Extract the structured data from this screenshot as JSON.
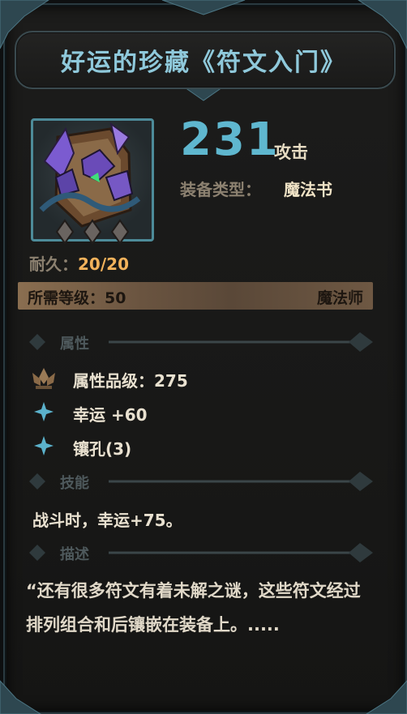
{
  "title": "好运的珍藏《符文入门》",
  "attack": {
    "value": "231",
    "label": "攻击"
  },
  "equip_type": {
    "label": "装备类型：",
    "value": "魔法书"
  },
  "durability": {
    "label": "耐久：",
    "current": "20",
    "sep": "/",
    "max": "20"
  },
  "requirement": {
    "label": "所需等级：50",
    "class": "魔法师"
  },
  "sections": {
    "attributes": "属性",
    "skill": "技能",
    "description": "描述"
  },
  "attributes": [
    {
      "icon": "lotus-icon",
      "text": "属性品级：275"
    },
    {
      "icon": "sparkle-icon",
      "text": "幸运 +60"
    },
    {
      "icon": "sparkle-icon",
      "text": "镶孔(3)"
    }
  ],
  "skill_text": "战斗时，幸运+75。",
  "description_text": "“还有很多符文有着未解之谜，这些符文经过排列组合和后镶嵌在装备上。.....",
  "socket_count": 3,
  "colors": {
    "title": "#8fc9db",
    "attack": "#5fb7cf",
    "durability": "#f2b25b",
    "accent": "#4d8b99"
  }
}
